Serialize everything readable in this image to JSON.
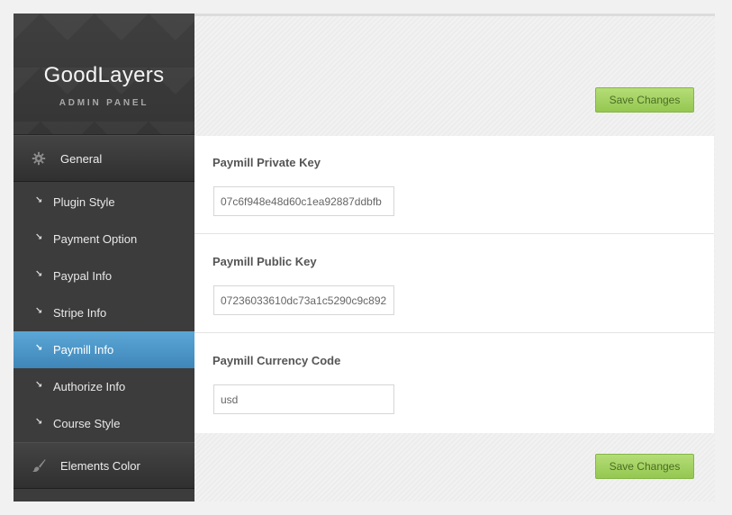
{
  "logo": {
    "title": "GoodLayers",
    "subtitle": "ADMIN PANEL"
  },
  "sidebar": {
    "general_label": "General",
    "items": [
      {
        "label": "Plugin Style"
      },
      {
        "label": "Payment Option"
      },
      {
        "label": "Paypal Info"
      },
      {
        "label": "Stripe Info"
      },
      {
        "label": "Paymill Info",
        "active": true
      },
      {
        "label": "Authorize Info"
      },
      {
        "label": "Course Style"
      }
    ],
    "elements_color_label": "Elements Color",
    "active_color": "#4a96c9"
  },
  "actions": {
    "save_top": "Save Changes",
    "save_bottom": "Save Changes",
    "accent": "#a5d264"
  },
  "fields": {
    "private_key": {
      "label": "Paymill Private Key",
      "value": "07c6f948e48d60c1ea92887ddbfb"
    },
    "public_key": {
      "label": "Paymill Public Key",
      "value": "07236033610dc73a1c5290c9c892"
    },
    "currency_code": {
      "label": "Paymill Currency Code",
      "value": "usd"
    }
  }
}
